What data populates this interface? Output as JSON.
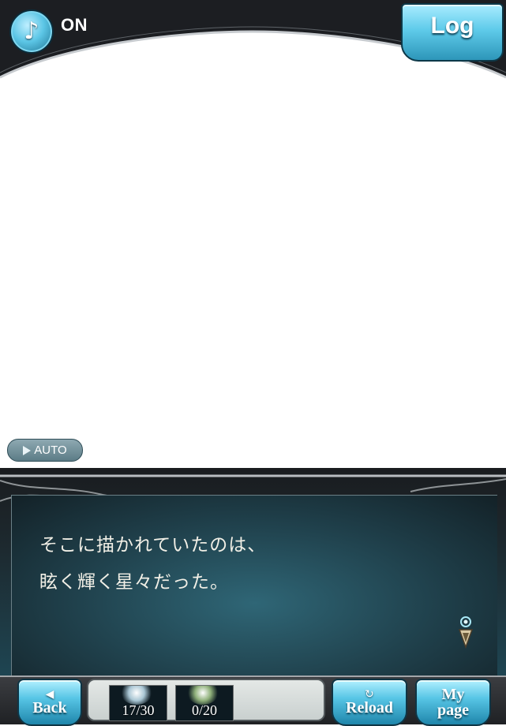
{
  "header": {
    "music_icon": "music-note-icon",
    "music_state": "ON",
    "log_label": "Log"
  },
  "scene": {
    "auto_label": "AUTO",
    "auto_icon": "play-triangle-icon"
  },
  "dialogue": {
    "lines": [
      "そこに描かれていたのは、",
      "眩く輝く星々だった。"
    ],
    "next_icon": "next-page-indicator-icon"
  },
  "footer": {
    "back_label": "Back",
    "back_icon": "arrow-left-icon",
    "ap_count": "17/30",
    "bp_count": "0/20",
    "reload_label": "Reload",
    "reload_icon": "refresh-icon",
    "mypage_line1": "My",
    "mypage_line2": "page"
  },
  "colors": {
    "accent": "#5cc6e6",
    "dialogue_text": "#f1efe6",
    "panel_dark": "#1d2a30"
  }
}
